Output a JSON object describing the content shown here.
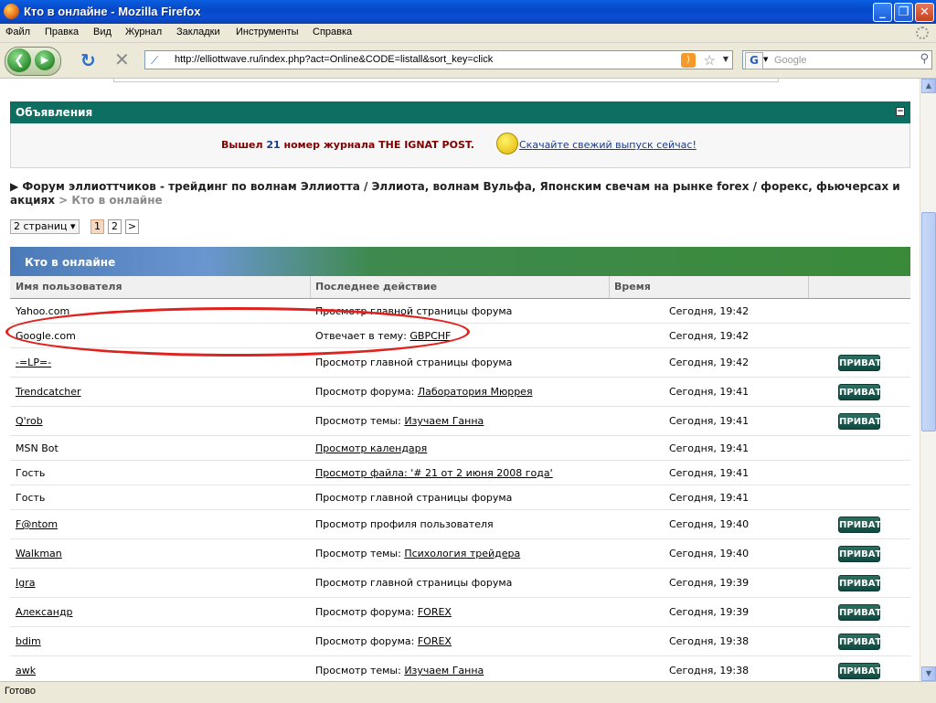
{
  "window": {
    "title": "Кто в онлайне - Mozilla Firefox"
  },
  "menu": [
    "Файл",
    "Правка",
    "Вид",
    "Журнал",
    "Закладки",
    "Инструменты",
    "Справка"
  ],
  "nav": {
    "url": "http://elliottwave.ru/index.php?act=Online&CODE=listall&sort_key=click",
    "search_placeholder": "Google"
  },
  "announcements": {
    "title": "Объявления",
    "message_prefix": "Вышел ",
    "issue_number": "21",
    "message_suffix": " номер журнала THE IGNAT POST",
    "message_end": ".",
    "download_link": "Скачайте свежий выпуск сейчас!"
  },
  "breadcrumb": {
    "forum": "Форум эллиоттчиков - трейдинг по волнам Эллиотта / Эллиота, волнам Вульфа, Японским свечам на рынке forex / форекс, фьючерсах и акциях",
    "separator": " > ",
    "current": "Кто в онлайне"
  },
  "pagination": {
    "pages_label": "2 страниц",
    "pages": [
      "1",
      "2"
    ],
    "active": "1",
    "next": ">"
  },
  "online_table": {
    "title": "Кто в онлайне",
    "columns": [
      "Имя пользователя",
      "Последнее действие",
      "Время"
    ],
    "private_label": "ПРИВАТ",
    "rows": [
      {
        "user": "Yahoo.com",
        "user_link": false,
        "action": "Просмотр главной страницы форума",
        "target": "",
        "action_link": false,
        "time": "Сегодня, 19:42",
        "priv": false
      },
      {
        "user": "Google.com",
        "user_link": false,
        "action": "Отвечает в тему: ",
        "target": "GBPCHF",
        "action_link": false,
        "time": "Сегодня, 19:42",
        "priv": false
      },
      {
        "user": "-=LP=-",
        "user_link": true,
        "action": "Просмотр главной страницы форума",
        "target": "",
        "action_link": false,
        "time": "Сегодня, 19:42",
        "priv": true
      },
      {
        "user": "Trendcatcher",
        "user_link": true,
        "action": "Просмотр форума: ",
        "target": "Лаборатория Мюррея",
        "action_link": false,
        "time": "Сегодня, 19:41",
        "priv": true
      },
      {
        "user": "Q'rob",
        "user_link": true,
        "action": "Просмотр темы: ",
        "target": "Изучаем Ганна",
        "action_link": false,
        "time": "Сегодня, 19:41",
        "priv": true
      },
      {
        "user": "MSN Bot",
        "user_link": false,
        "action": "Просмотр календаря",
        "target": "",
        "action_link": true,
        "time": "Сегодня, 19:41",
        "priv": false
      },
      {
        "user": "Гость",
        "user_link": false,
        "action": "Просмотр файла: '# 21 от 2 июня 2008 года'",
        "target": "",
        "action_link": true,
        "time": "Сегодня, 19:41",
        "priv": false
      },
      {
        "user": "Гость",
        "user_link": false,
        "action": "Просмотр главной страницы форума",
        "target": "",
        "action_link": false,
        "time": "Сегодня, 19:41",
        "priv": false
      },
      {
        "user": "F@ntom",
        "user_link": true,
        "action": "Просмотр профиля пользователя",
        "target": "",
        "action_link": false,
        "time": "Сегодня, 19:40",
        "priv": true
      },
      {
        "user": "Walkman",
        "user_link": true,
        "action": "Просмотр темы: ",
        "target": "Психология трейдера",
        "action_link": false,
        "time": "Сегодня, 19:40",
        "priv": true
      },
      {
        "user": "Igra",
        "user_link": true,
        "action": "Просмотр главной страницы форума",
        "target": "",
        "action_link": false,
        "time": "Сегодня, 19:39",
        "priv": true
      },
      {
        "user": "Александр",
        "user_link": true,
        "action": "Просмотр форума: ",
        "target": "FOREX",
        "action_link": false,
        "time": "Сегодня, 19:39",
        "priv": true
      },
      {
        "user": "bdim",
        "user_link": true,
        "action": "Просмотр форума: ",
        "target": "FOREX",
        "action_link": false,
        "time": "Сегодня, 19:38",
        "priv": true
      },
      {
        "user": "awk",
        "user_link": true,
        "action": "Просмотр темы: ",
        "target": "Изучаем Ганна",
        "action_link": false,
        "time": "Сегодня, 19:38",
        "priv": true
      }
    ]
  },
  "status": {
    "text": "Готово"
  },
  "colors": {
    "header_teal": "#0d6e62",
    "annotation_red": "#e0221e",
    "priv_button": "#1a5a50"
  }
}
